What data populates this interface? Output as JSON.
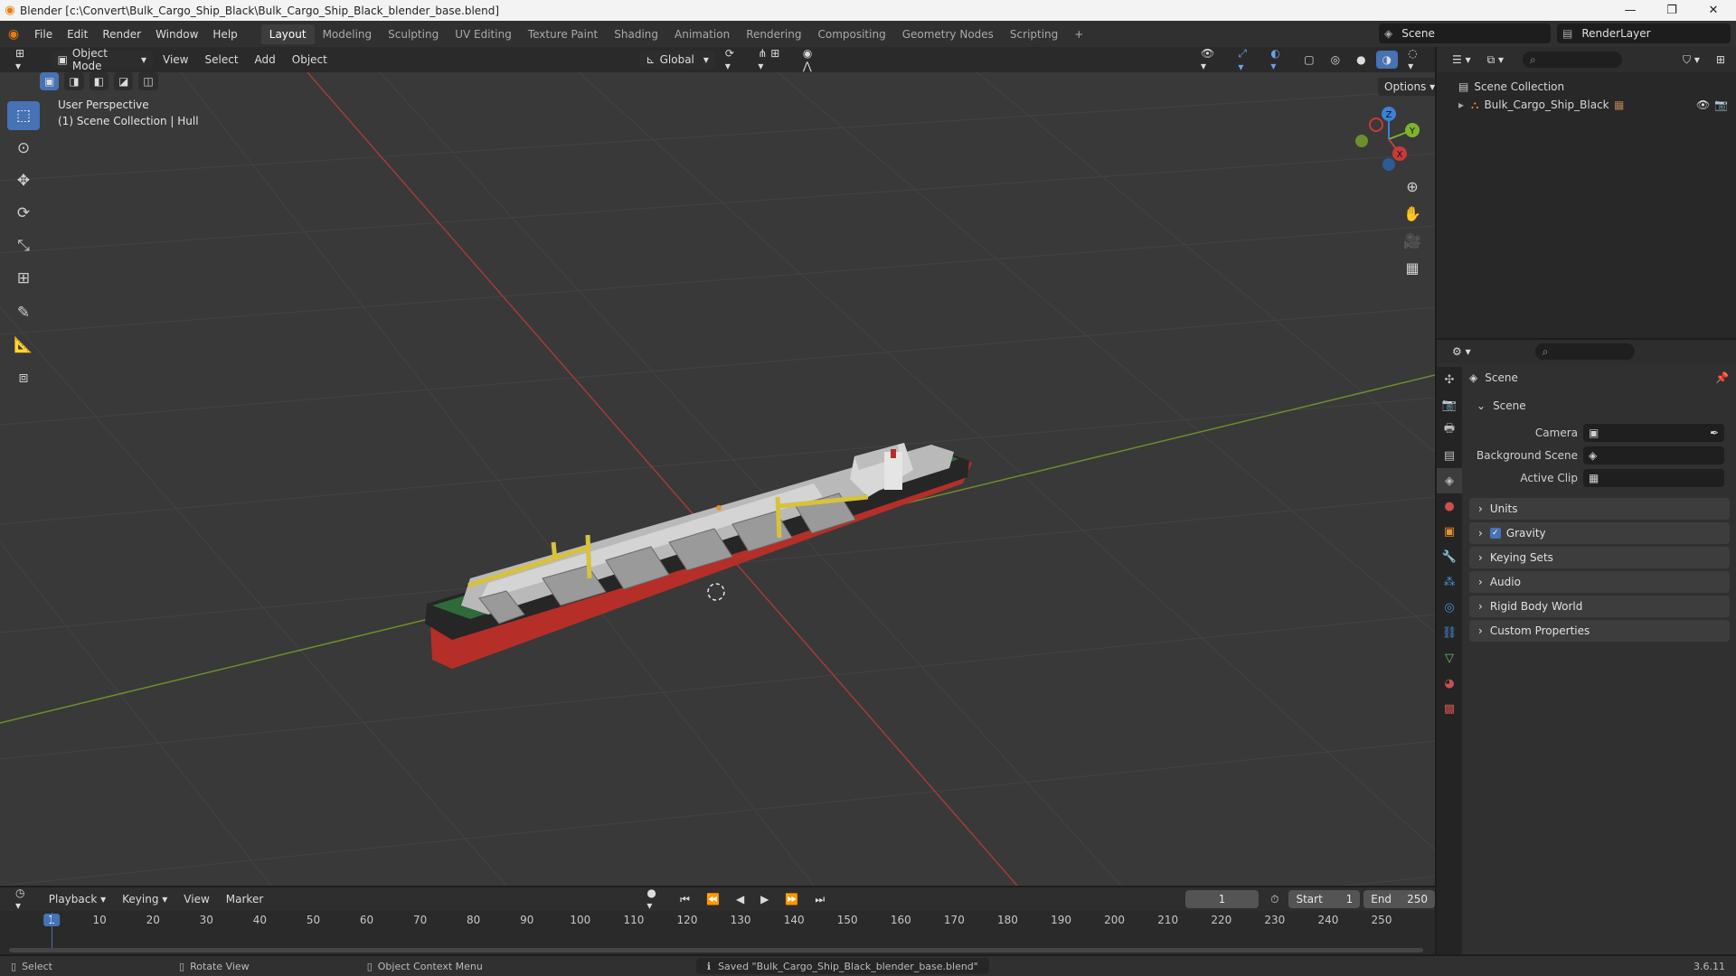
{
  "window": {
    "title": "Blender [c:\\Convert\\Bulk_Cargo_Ship_Black\\Bulk_Cargo_Ship_Black_blender_base.blend]",
    "icon": "blender-logo-icon"
  },
  "menus": [
    "File",
    "Edit",
    "Render",
    "Window",
    "Help"
  ],
  "workspaces": [
    "Layout",
    "Modeling",
    "Sculpting",
    "UV Editing",
    "Texture Paint",
    "Shading",
    "Animation",
    "Rendering",
    "Compositing",
    "Geometry Nodes",
    "Scripting"
  ],
  "active_workspace": "Layout",
  "scene_selector": {
    "scene": "Scene",
    "view_layer": "RenderLayer"
  },
  "viewport_header": {
    "mode": "Object Mode",
    "menus": [
      "View",
      "Select",
      "Add",
      "Object"
    ],
    "orientation": "Global",
    "options_label": "Options"
  },
  "viewport": {
    "info_line1": "User Perspective",
    "info_line2": "(1) Scene Collection | Hull",
    "gizmo_axes": [
      "X",
      "Y",
      "Z"
    ]
  },
  "tools": [
    "select-box-icon",
    "cursor-icon",
    "move-icon",
    "rotate-icon",
    "scale-icon",
    "transform-icon",
    "annotate-icon",
    "measure-icon",
    "add-cube-icon"
  ],
  "outliner": {
    "root": "Scene Collection",
    "items": [
      {
        "label": "Bulk_Cargo_Ship_Black"
      }
    ]
  },
  "properties": {
    "header": "Scene",
    "scene_panel": "Scene",
    "fields": [
      {
        "label": "Camera",
        "value": ""
      },
      {
        "label": "Background Scene",
        "value": ""
      },
      {
        "label": "Active Clip",
        "value": ""
      }
    ],
    "panels": [
      "Units",
      "Gravity",
      "Keying Sets",
      "Audio",
      "Rigid Body World",
      "Custom Properties"
    ]
  },
  "timeline": {
    "menus": [
      "Playback",
      "Keying",
      "View",
      "Marker"
    ],
    "current_frame": "1",
    "start_label": "Start",
    "start": "1",
    "end_label": "End",
    "end": "250",
    "ticks": [
      "1",
      "10",
      "20",
      "30",
      "40",
      "50",
      "60",
      "70",
      "80",
      "90",
      "100",
      "110",
      "120",
      "130",
      "140",
      "150",
      "160",
      "170",
      "180",
      "190",
      "200",
      "210",
      "220",
      "230",
      "240",
      "250"
    ]
  },
  "statusbar": {
    "select": "Select",
    "rotate": "Rotate View",
    "context": "Object Context Menu",
    "message": "Saved \"Bulk_Cargo_Ship_Black_blender_base.blend\"",
    "version": "3.6.11"
  },
  "colors": {
    "accent": "#4772b3",
    "x_axis": "#c83a3a",
    "y_axis": "#7fb32a",
    "z_axis": "#3d7fd6",
    "hull_red": "#c8332c",
    "crane_yellow": "#d8c23a"
  }
}
